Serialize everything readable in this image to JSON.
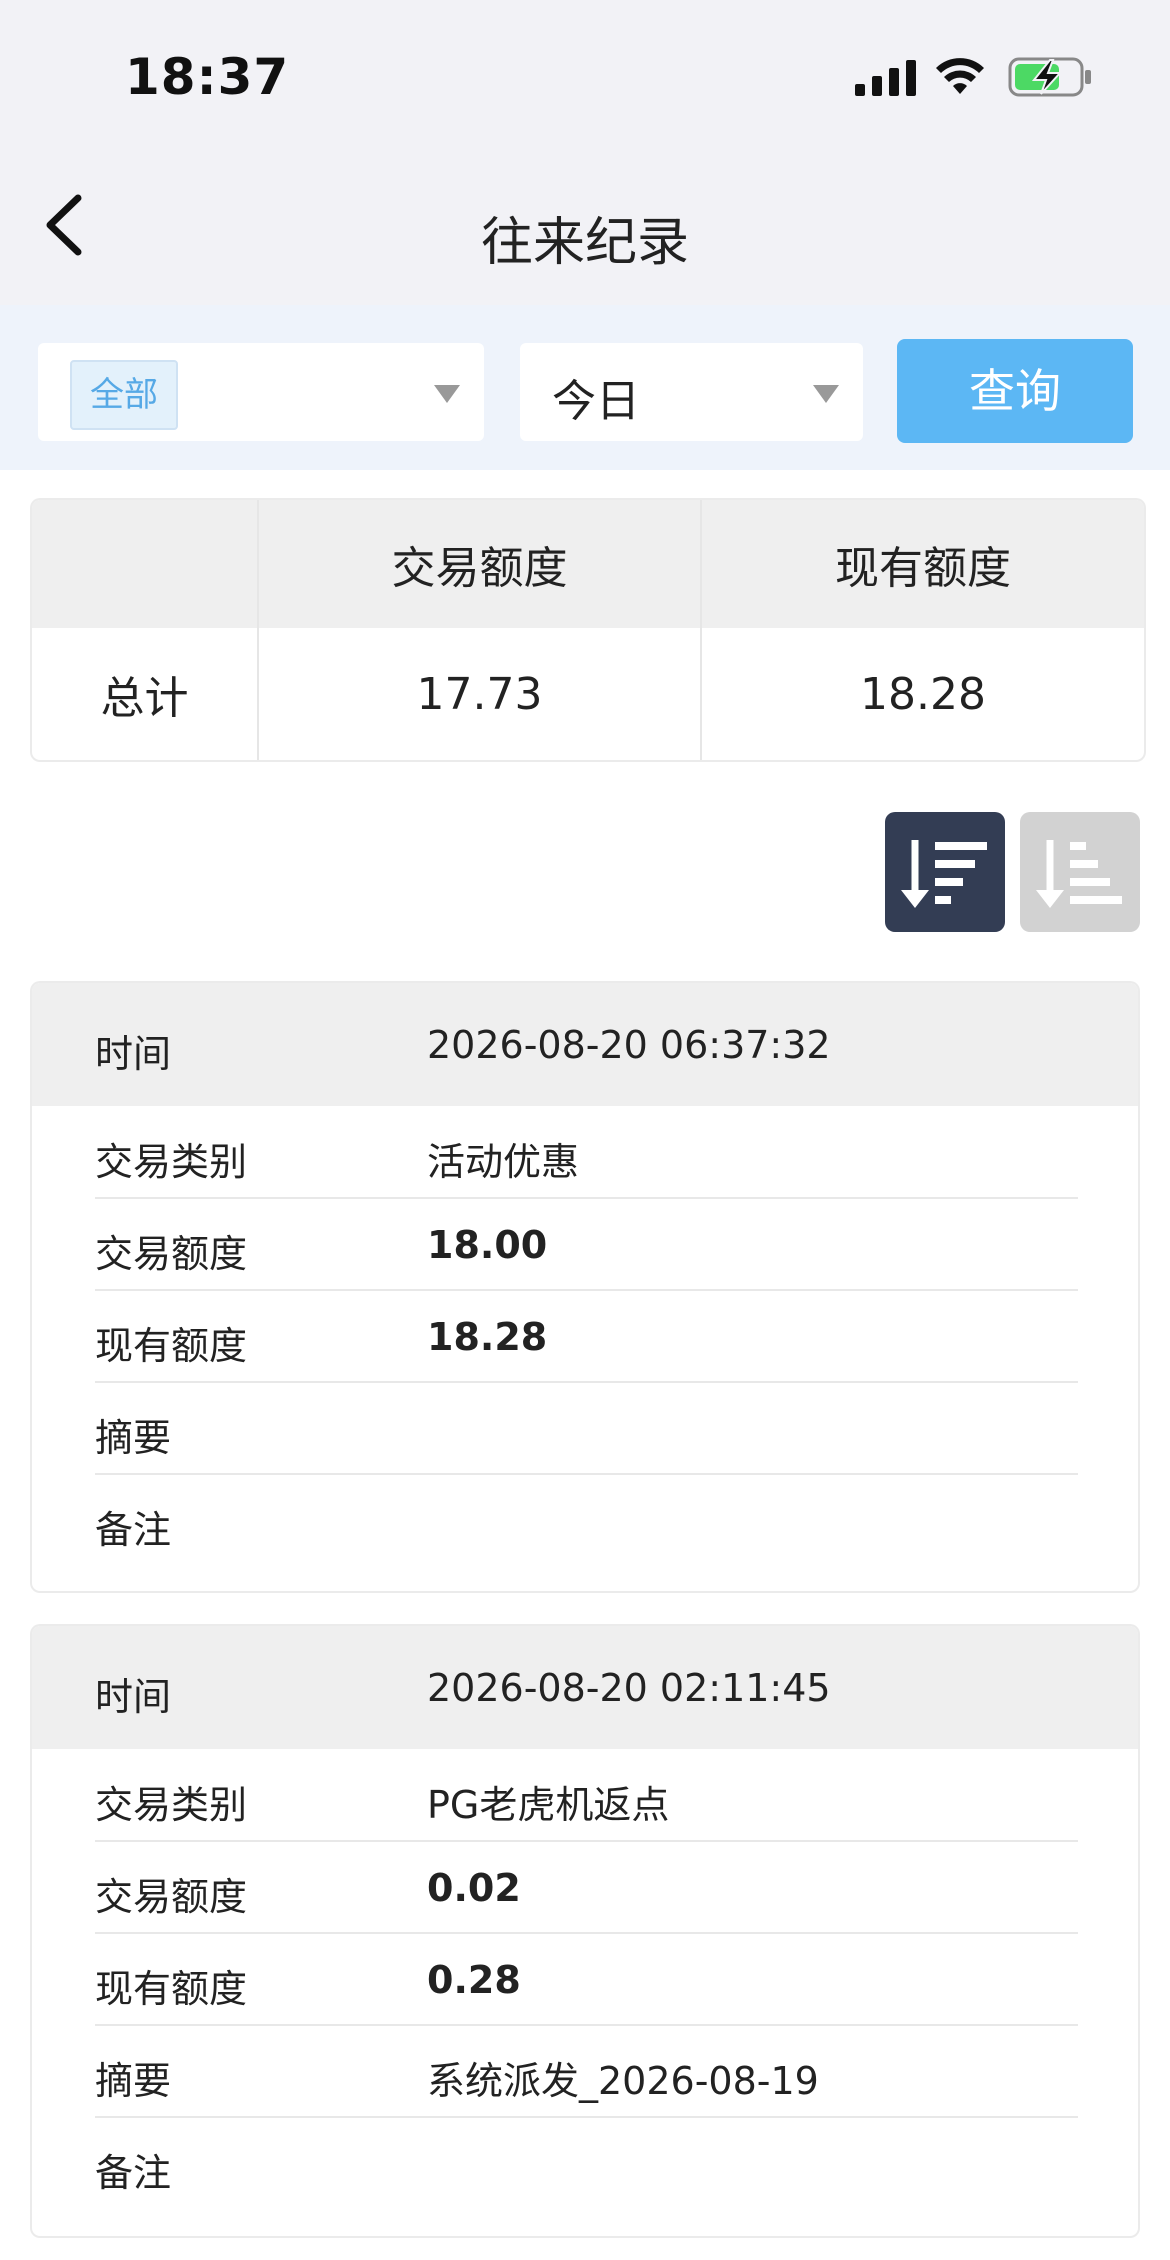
{
  "status_bar": {
    "time": "18:37"
  },
  "nav": {
    "title": "往来纪录"
  },
  "filter": {
    "type_chip": "全部",
    "period": "今日",
    "query_label": "查询"
  },
  "summary": {
    "headers": [
      "",
      "交易额度",
      "现有额度"
    ],
    "row_label": "总计",
    "trade_total": "17.73",
    "current_total": "18.28"
  },
  "colors": {
    "accent": "#5cb7f4",
    "sort_active": "#333d54",
    "sort_inactive": "#d2d2d2"
  },
  "records": [
    {
      "time_label": "时间",
      "time": "2026-08-20 06:37:32",
      "type_label": "交易类别",
      "type": "活动优惠",
      "trade_label": "交易额度",
      "trade": "18.00",
      "current_label": "现有额度",
      "current": "18.28",
      "summary_label": "摘要",
      "summary": "",
      "note_label": "备注",
      "note": ""
    },
    {
      "time_label": "时间",
      "time": "2026-08-20 02:11:45",
      "type_label": "交易类别",
      "type": "PG老虎机返点",
      "trade_label": "交易额度",
      "trade": "0.02",
      "current_label": "现有额度",
      "current": "0.28",
      "summary_label": "摘要",
      "summary": "系统派发_2026-08-19",
      "note_label": "备注",
      "note": ""
    }
  ]
}
